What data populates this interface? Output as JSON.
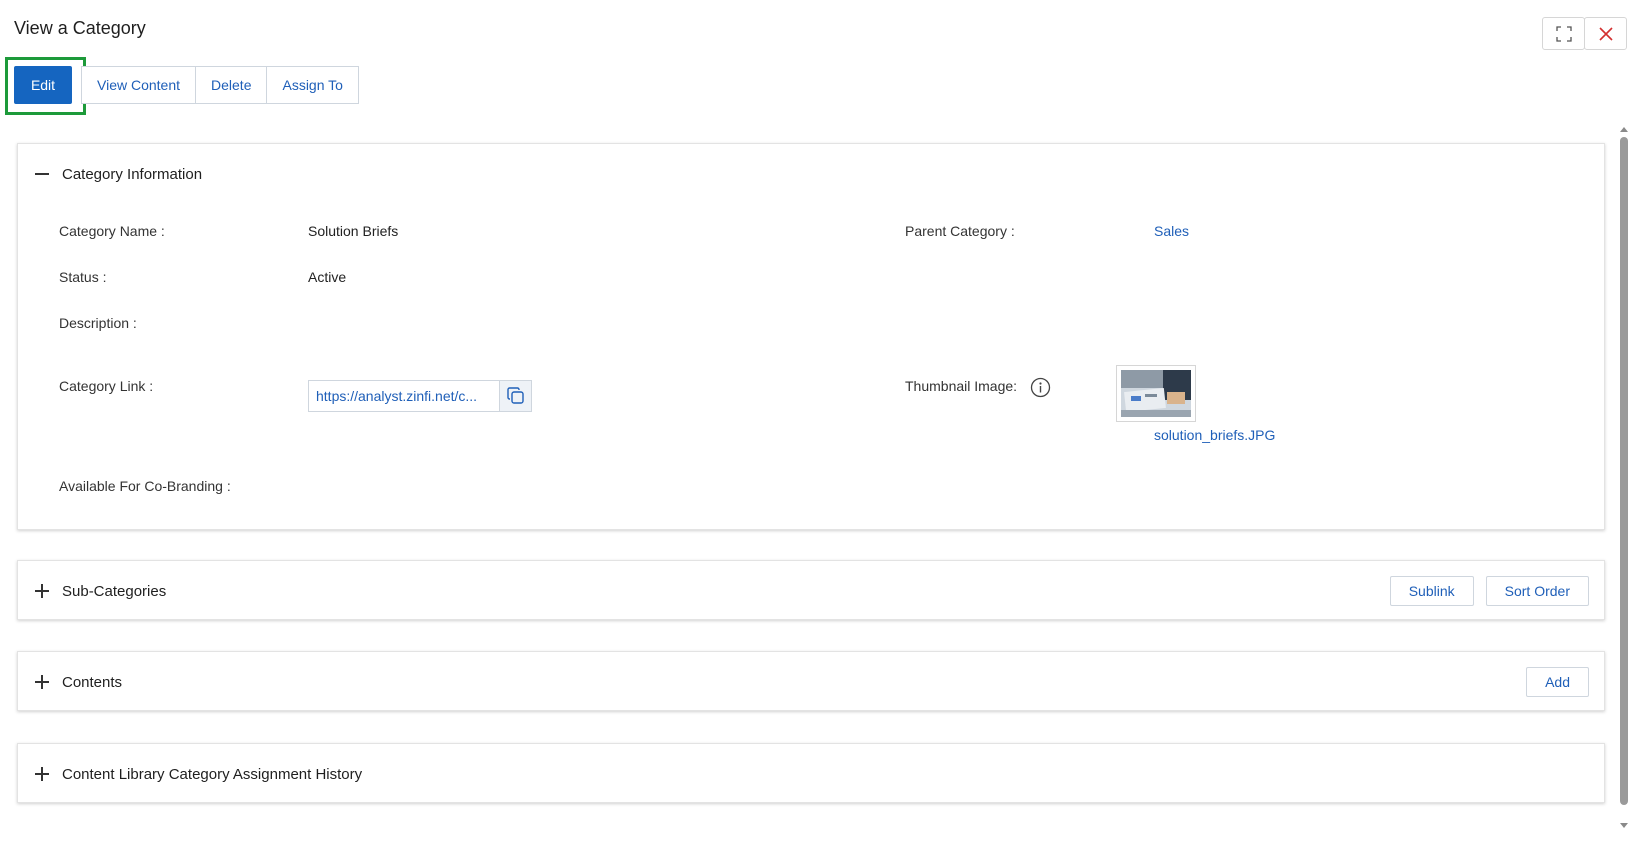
{
  "page": {
    "title": "View a Category"
  },
  "toolbar": {
    "edit": "Edit",
    "view_content": "View Content",
    "delete": "Delete",
    "assign_to": "Assign To"
  },
  "window_controls": {
    "expand_icon": "expand-icon",
    "close_icon": "close-icon"
  },
  "category_information": {
    "title": "Category Information",
    "fields": {
      "category_name_label": "Category Name :",
      "category_name_value": "Solution Briefs",
      "parent_category_label": "Parent Category :",
      "parent_category_value": "Sales",
      "status_label": "Status :",
      "status_value": "Active",
      "description_label": "Description :",
      "description_value": "",
      "category_link_label": "Category Link :",
      "category_link_value": "https://analyst.zinfi.net/c...",
      "thumbnail_label": "Thumbnail Image:",
      "thumbnail_file": "solution_briefs.JPG",
      "co_branding_label": "Available For Co-Branding :",
      "co_branding_value": ""
    }
  },
  "sub_categories": {
    "title": "Sub-Categories",
    "sublink": "Sublink",
    "sort_order": "Sort Order"
  },
  "contents": {
    "title": "Contents",
    "add": "Add"
  },
  "history": {
    "title": "Content Library Category Assignment History"
  },
  "colors": {
    "accent": "#1565c0",
    "link": "#1f5fb8",
    "highlight": "#1d9a3a",
    "close": "#d32f2f"
  }
}
